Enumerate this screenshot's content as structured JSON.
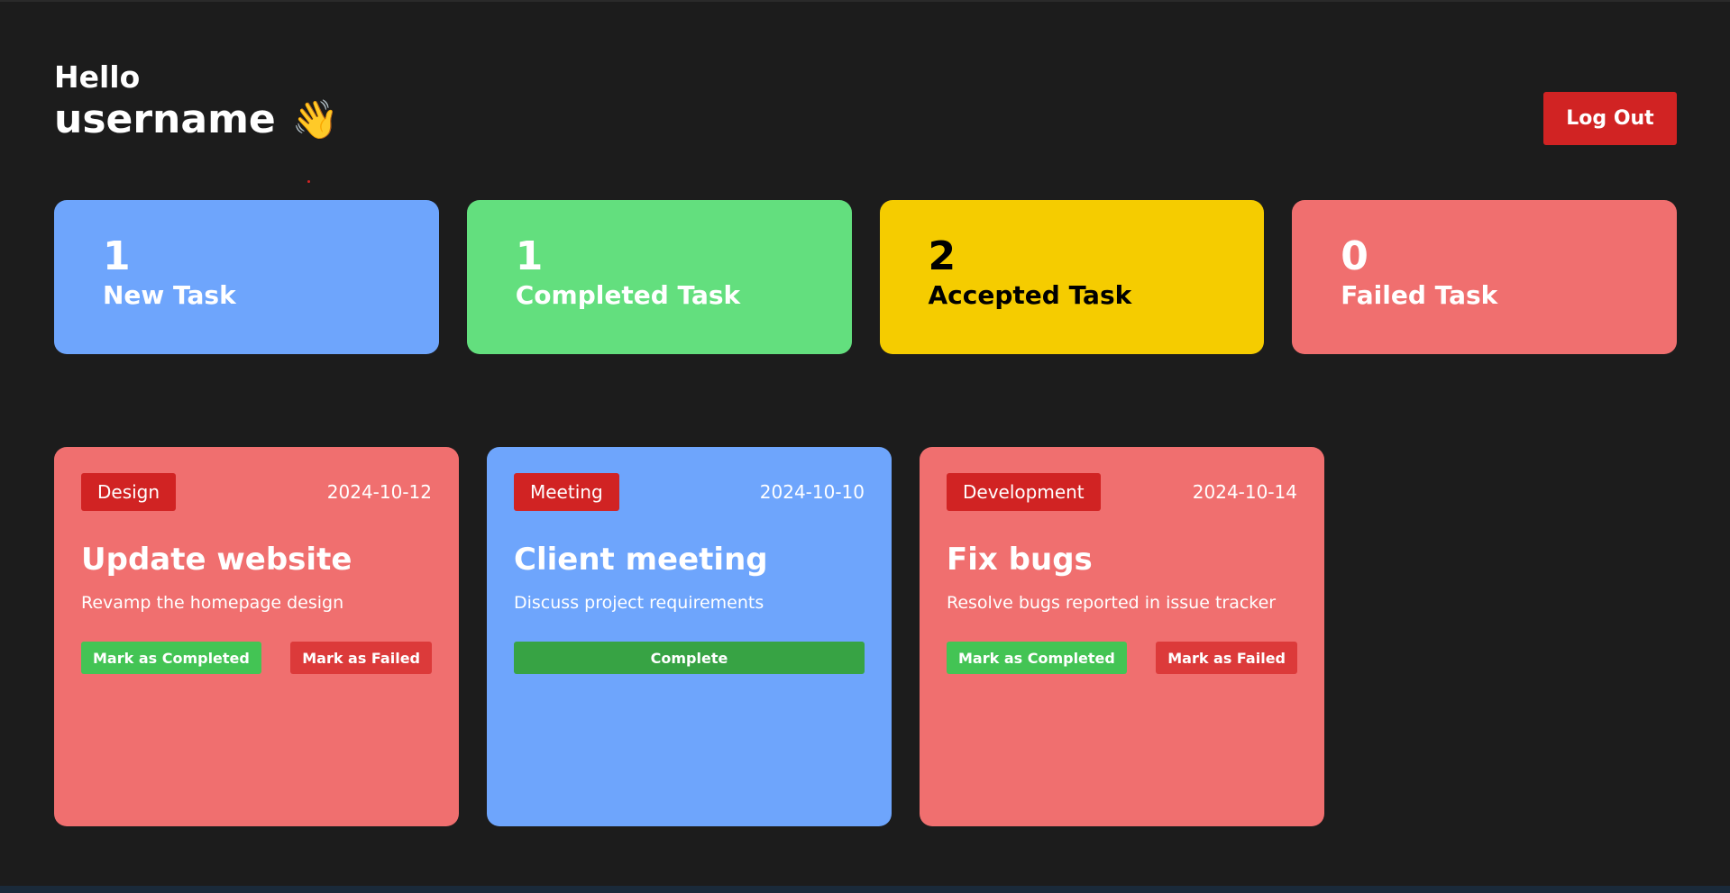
{
  "header": {
    "hello": "Hello",
    "username": "username",
    "wave_emoji": "👋",
    "logout_label": "Log Out"
  },
  "stats": [
    {
      "count": "1",
      "label": "New Task",
      "color": "#6ea5fc",
      "text_color": "#ffffff"
    },
    {
      "count": "1",
      "label": "Completed Task",
      "color": "#63df7e",
      "text_color": "#ffffff"
    },
    {
      "count": "2",
      "label": "Accepted Task",
      "color": "#f5cc00",
      "text_color": "#000000"
    },
    {
      "count": "0",
      "label": "Failed Task",
      "color": "#f06f6f",
      "text_color": "#ffffff"
    }
  ],
  "tasks": [
    {
      "category": "Design",
      "date": "2024-10-12",
      "title": "Update website",
      "description": "Revamp the homepage design",
      "color": "#f06f6f",
      "complete_label": "Mark as Completed",
      "failed_label": "Mark as Failed"
    },
    {
      "category": "Meeting",
      "date": "2024-10-10",
      "title": "Client meeting",
      "description": "Discuss project requirements",
      "color": "#6ea5fc",
      "action_label": "Complete"
    },
    {
      "category": "Development",
      "date": "2024-10-14",
      "title": "Fix bugs",
      "description": "Resolve bugs reported in issue tracker",
      "color": "#f06f6f",
      "complete_label": "Mark as Completed",
      "failed_label": "Mark as Failed"
    }
  ],
  "colors": {
    "background": "#1c1c1c",
    "accent_red": "#d12323",
    "complete_green": "#43c454",
    "failed_red": "#dc3a3a"
  }
}
